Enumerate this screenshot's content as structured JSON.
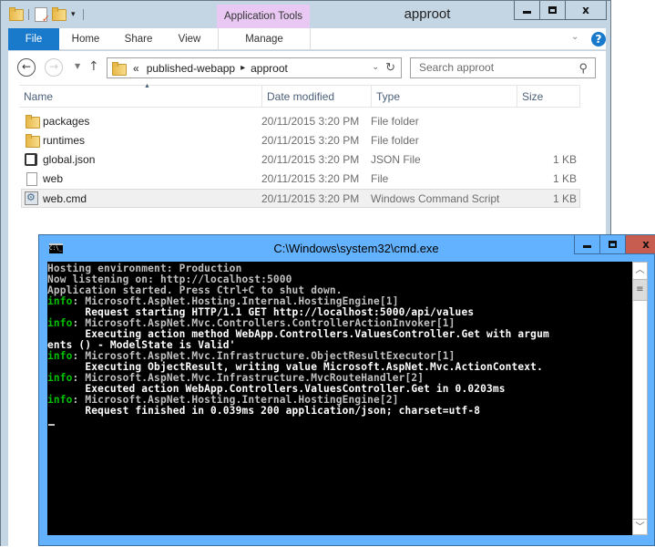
{
  "explorer": {
    "title": "approot",
    "contextual_tab_group": "Application Tools",
    "ribbon_tabs": [
      {
        "label": "File",
        "active": true
      },
      {
        "label": "Home"
      },
      {
        "label": "Share"
      },
      {
        "label": "View"
      },
      {
        "label": "Manage"
      }
    ],
    "help_label": "?",
    "window_buttons": {
      "minimize": "minimize",
      "maximize": "maximize",
      "close": "x"
    },
    "address": {
      "overflow": "«",
      "crumbs": [
        "published-webapp",
        "approot"
      ],
      "separator": "▸"
    },
    "search": {
      "placeholder": "Search approot"
    },
    "columns": [
      "Name",
      "Date modified",
      "Type",
      "Size"
    ],
    "sort_column": "Name",
    "files": [
      {
        "name": "packages",
        "date": "20/11/2015 3:20 PM",
        "type": "File folder",
        "size": "",
        "icon": "folder-icon"
      },
      {
        "name": "runtimes",
        "date": "20/11/2015 3:20 PM",
        "type": "File folder",
        "size": "",
        "icon": "folder-icon"
      },
      {
        "name": "global.json",
        "date": "20/11/2015 3:20 PM",
        "type": "JSON File",
        "size": "1 KB",
        "icon": "json-file-icon"
      },
      {
        "name": "web",
        "date": "20/11/2015 3:20 PM",
        "type": "File",
        "size": "1 KB",
        "icon": "file-icon"
      },
      {
        "name": "web.cmd",
        "date": "20/11/2015 3:20 PM",
        "type": "Windows Command Script",
        "size": "1 KB",
        "icon": "cmd-script-icon",
        "selected": true
      }
    ]
  },
  "cmd": {
    "title": "C:\\Windows\\system32\\cmd.exe",
    "icon_text": "C:\\_",
    "colors": {
      "background": "#000000",
      "text": "#c0c0c0",
      "info": "#00c000",
      "frame": "#63b2ff",
      "close": "#c75c50"
    },
    "lines": [
      {
        "parts": [
          {
            "t": "Hosting environment: Production",
            "c": "grey"
          }
        ]
      },
      {
        "parts": [
          {
            "t": "Now listening on: http://localhost:5000",
            "c": "grey"
          }
        ]
      },
      {
        "parts": [
          {
            "t": "Application started. Press Ctrl+C to shut down.",
            "c": "grey"
          }
        ]
      },
      {
        "parts": [
          {
            "t": "info",
            "c": "green"
          },
          {
            "t": ": Microsoft.AspNet.Hosting.Internal.HostingEngine[1]",
            "c": "grey"
          }
        ]
      },
      {
        "parts": [
          {
            "t": "      Request starting HTTP/1.1 GET http://localhost:5000/api/values",
            "c": "white"
          }
        ]
      },
      {
        "parts": [
          {
            "t": "info",
            "c": "green"
          },
          {
            "t": ": Microsoft.AspNet.Mvc.Controllers.ControllerActionInvoker[1]",
            "c": "grey"
          }
        ]
      },
      {
        "parts": [
          {
            "t": "      Executing action method WebApp.Controllers.ValuesController.Get with argum",
            "c": "white"
          }
        ]
      },
      {
        "parts": [
          {
            "t": "ents () - ModelState is Valid'",
            "c": "white"
          }
        ]
      },
      {
        "parts": [
          {
            "t": "info",
            "c": "green"
          },
          {
            "t": ": Microsoft.AspNet.Mvc.Infrastructure.ObjectResultExecutor[1]",
            "c": "grey"
          }
        ]
      },
      {
        "parts": [
          {
            "t": "      Executing ObjectResult, writing value Microsoft.AspNet.Mvc.ActionContext.",
            "c": "white"
          }
        ]
      },
      {
        "parts": [
          {
            "t": "info",
            "c": "green"
          },
          {
            "t": ": Microsoft.AspNet.Mvc.Infrastructure.MvcRouteHandler[2]",
            "c": "grey"
          }
        ]
      },
      {
        "parts": [
          {
            "t": "      Executed action WebApp.Controllers.ValuesController.Get in 0.0203ms",
            "c": "white"
          }
        ]
      },
      {
        "parts": [
          {
            "t": "info",
            "c": "green"
          },
          {
            "t": ": Microsoft.AspNet.Hosting.Internal.HostingEngine[2]",
            "c": "grey"
          }
        ]
      },
      {
        "parts": [
          {
            "t": "      Request finished in 0.039ms 200 application/json; charset=utf-8",
            "c": "white"
          }
        ]
      }
    ]
  }
}
